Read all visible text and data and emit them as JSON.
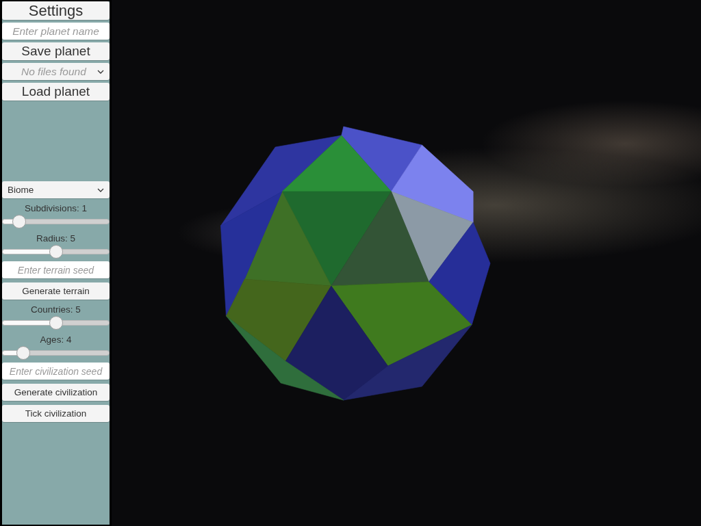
{
  "file_panel": [
    {
      "kind": "title",
      "text": "Settings"
    },
    {
      "kind": "field",
      "placeholder": "Enter planet name"
    },
    {
      "kind": "big-button",
      "text": "Save planet"
    },
    {
      "kind": "file-dropdown",
      "text": "No files found"
    },
    {
      "kind": "big-button",
      "text": "Load planet"
    }
  ],
  "generation_panel": [
    {
      "kind": "dropdown",
      "text": "Biome"
    },
    {
      "kind": "slider",
      "label": "Subdivisions: 1",
      "level": 0.16
    },
    {
      "kind": "slider",
      "label": "Radius: 5",
      "level": 0.5
    },
    {
      "kind": "field",
      "placeholder": "Enter terrain seed"
    },
    {
      "kind": "button",
      "text": "Generate terrain"
    },
    {
      "kind": "slider",
      "label": "Countries: 5",
      "level": 0.5
    },
    {
      "kind": "slider",
      "label": "Ages: 4",
      "level": 0.2
    },
    {
      "kind": "field",
      "placeholder": "Enter civilization seed"
    },
    {
      "kind": "button",
      "text": "Generate civilization"
    },
    {
      "kind": "button",
      "text": "Tick civilization"
    }
  ]
}
